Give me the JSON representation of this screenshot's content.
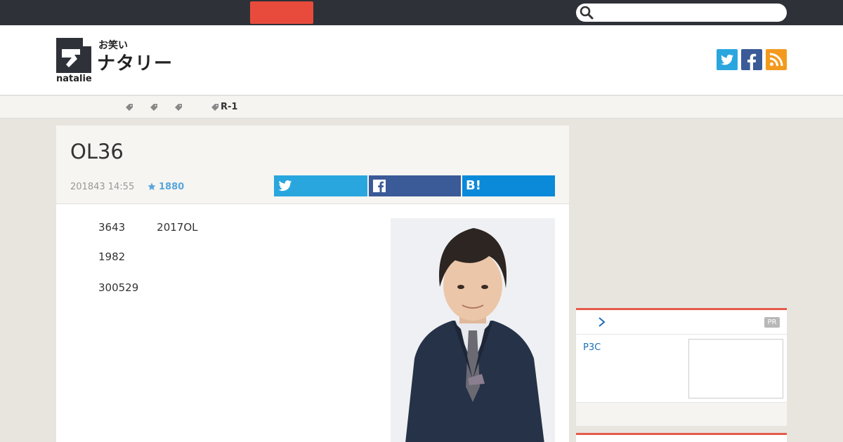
{
  "search": {
    "placeholder": ""
  },
  "colors": {
    "accent_red": "#e84b3c",
    "twitter": "#2aa6de",
    "facebook": "#3a5a98",
    "rss": "#f39a1e",
    "hatena": "#0b8ad9"
  },
  "logo": {
    "small": "お笑い",
    "big": "ナタリー",
    "word": "natalie"
  },
  "tags": [
    {
      "label": ""
    },
    {
      "label": ""
    },
    {
      "label": ""
    },
    {
      "label": "R-1"
    }
  ],
  "article": {
    "title": "OL36",
    "date": "201843 14:55",
    "stars": "1880",
    "hatena_label": "B!",
    "paragraphs": [
      {
        "text": "3643　　　2017OL"
      },
      {
        "text": "1982"
      },
      {
        "text": "300529"
      }
    ]
  },
  "sidebar": {
    "pr_badge": "PR",
    "pr_link": "P3C"
  },
  "icons": [
    "search-icon",
    "twitter-icon",
    "facebook-icon",
    "rss-icon",
    "tag-icon",
    "star-icon",
    "chevron-right-icon"
  ]
}
